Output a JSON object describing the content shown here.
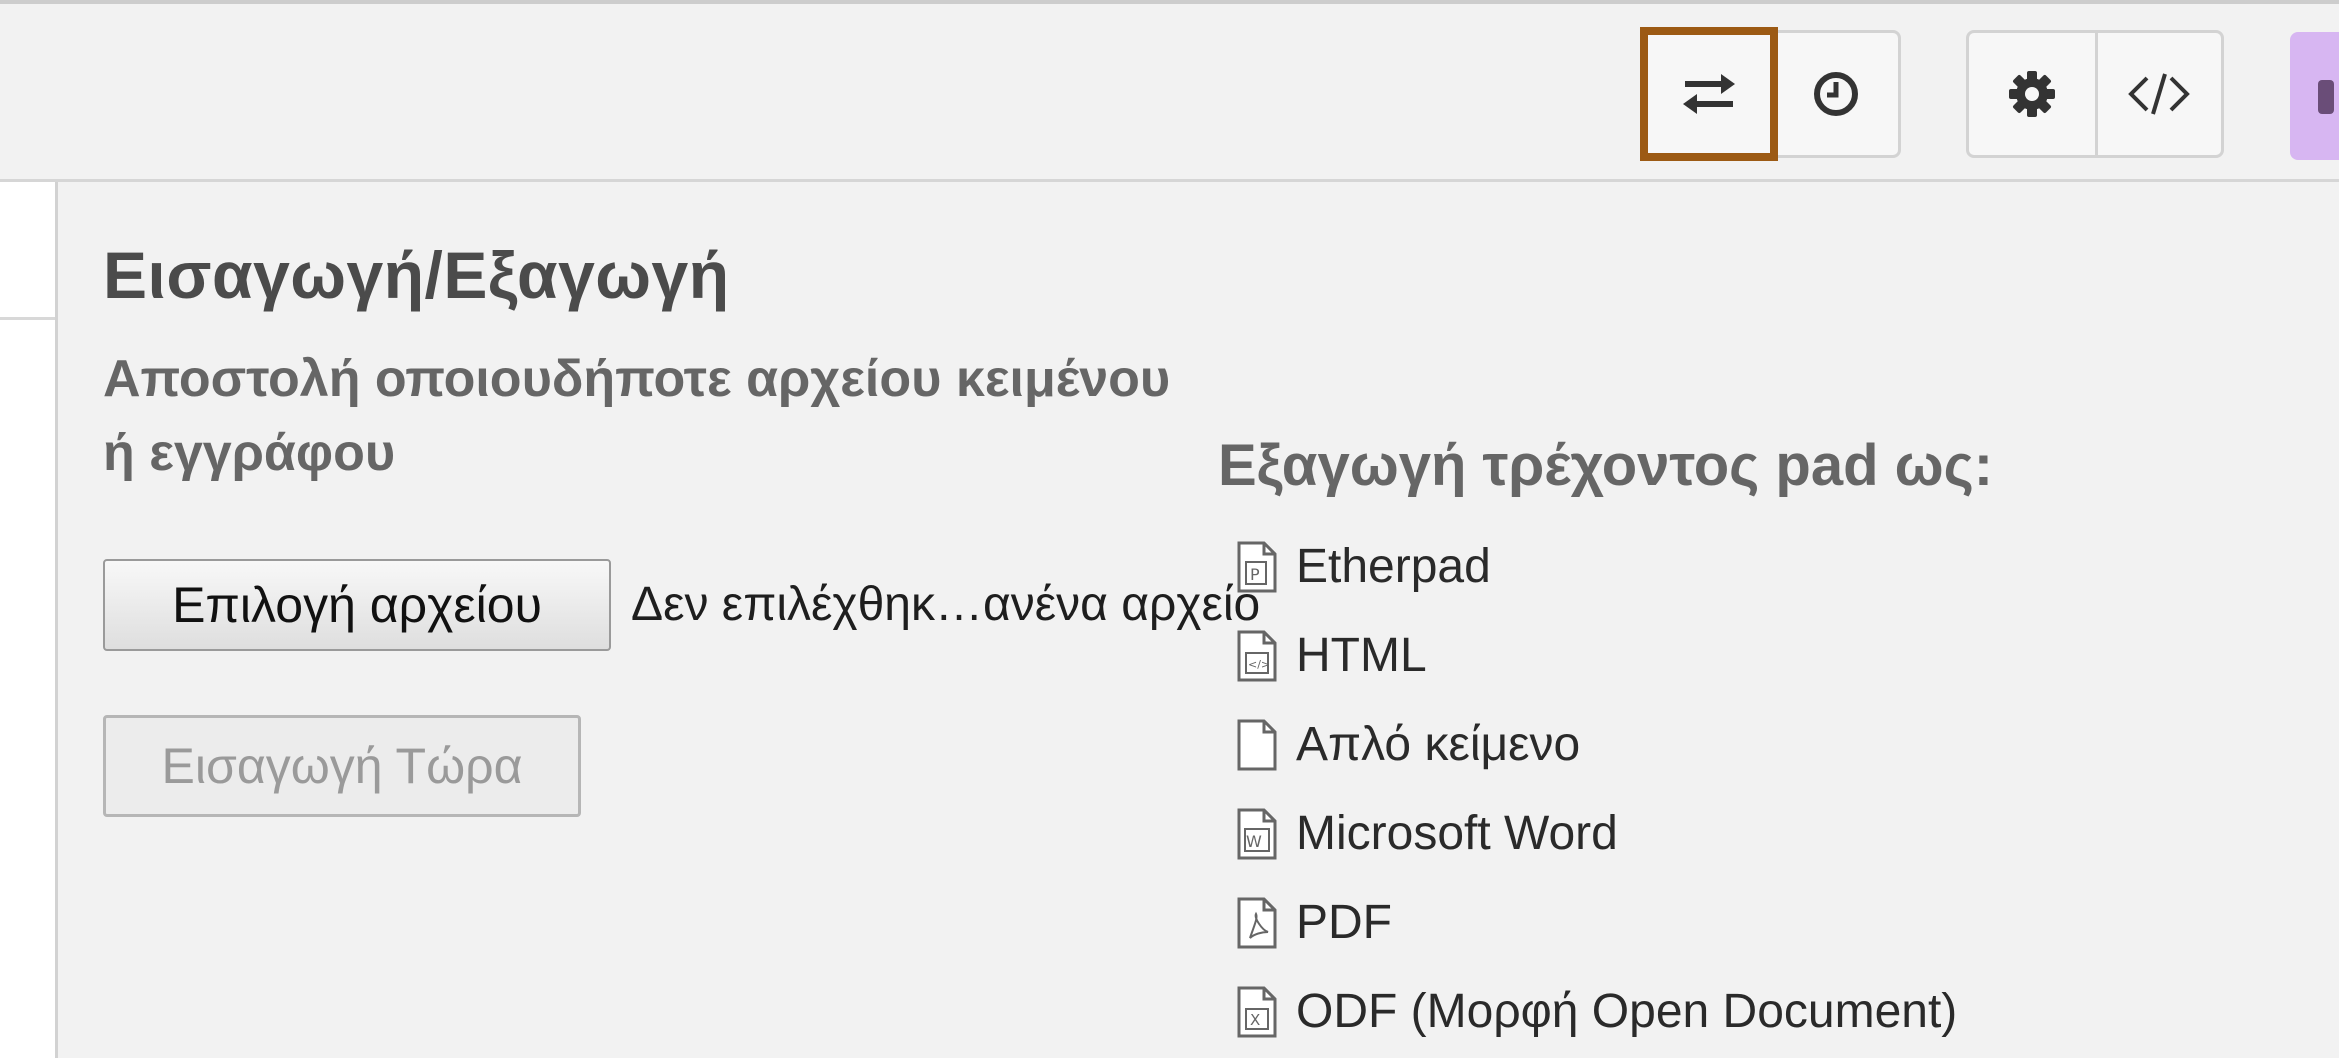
{
  "toolbar": {
    "buttons": [
      {
        "name": "import-export",
        "icon": "swap-arrows-icon",
        "active": true
      },
      {
        "name": "timeslider",
        "icon": "clock-icon"
      },
      {
        "name": "settings",
        "icon": "gear-icon"
      },
      {
        "name": "embed",
        "icon": "code-icon"
      }
    ],
    "active_outline_color": "#9c5a14"
  },
  "panel": {
    "title": "Εισαγωγή/Εξαγωγή",
    "import": {
      "subtitle": "Αποστολή οποιουδήποτε αρχείου κειμένου ή εγγράφου",
      "choose_file_label": "Επιλογή αρχείου",
      "file_status": "Δεν επιλέχθηκ…ανένα αρχείο",
      "import_now_label": "Εισαγωγή Τώρα"
    },
    "export": {
      "title": "Εξαγωγή τρέχοντος pad ως:",
      "items": [
        {
          "label": "Etherpad",
          "icon": "etherpad-file-icon"
        },
        {
          "label": "HTML",
          "icon": "html-file-icon"
        },
        {
          "label": "Απλό κείμενο",
          "icon": "text-file-icon"
        },
        {
          "label": "Microsoft Word",
          "icon": "word-file-icon"
        },
        {
          "label": "PDF",
          "icon": "pdf-file-icon"
        },
        {
          "label": "ODF (Μορφή Open Document)",
          "icon": "odf-file-icon"
        }
      ]
    }
  }
}
